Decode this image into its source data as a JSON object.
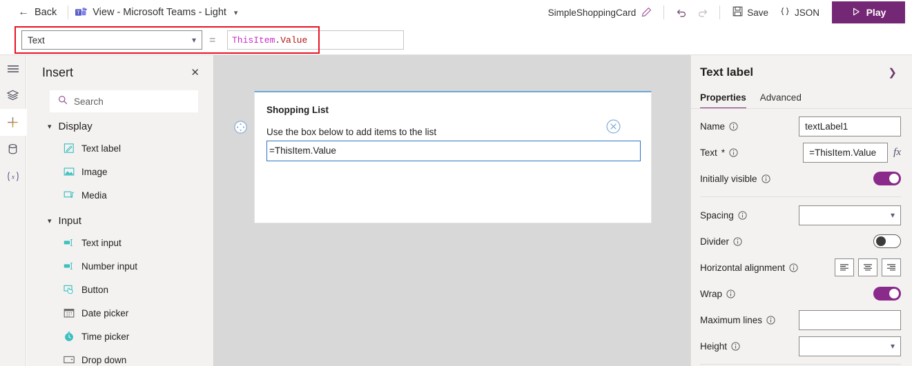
{
  "topbar": {
    "back_label": "Back",
    "app_title": "View - Microsoft Teams - Light",
    "doc_name": "SimpleShoppingCard",
    "edit_icon": "pencil-icon",
    "undo_icon": "undo-icon",
    "redo_icon": "redo-icon",
    "save_label": "Save",
    "json_label": "JSON",
    "json_icon": "braces-icon",
    "play_label": "Play"
  },
  "formula_bar": {
    "property": "Text",
    "equals": "=",
    "formula_object": "ThisItem",
    "formula_dot": ".",
    "formula_property": "Value",
    "highlight_color": "#e81123"
  },
  "rail": {
    "items": [
      {
        "name": "menu-icon",
        "label": "Menu",
        "active": false
      },
      {
        "name": "tree-view-icon",
        "label": "Tree view",
        "active": false
      },
      {
        "name": "plus-icon",
        "label": "Insert",
        "active": true
      },
      {
        "name": "data-icon",
        "label": "Data",
        "active": false
      },
      {
        "name": "variables-icon",
        "label": "Variables",
        "active": false
      }
    ]
  },
  "insert": {
    "title": "Insert",
    "close_icon": "close-icon",
    "search_placeholder": "Search",
    "groups": [
      {
        "label": "Display",
        "items": [
          {
            "label": "Text label",
            "icon": "text-label-icon"
          },
          {
            "label": "Image",
            "icon": "image-icon"
          },
          {
            "label": "Media",
            "icon": "media-icon"
          }
        ]
      },
      {
        "label": "Input",
        "items": [
          {
            "label": "Text input",
            "icon": "text-input-icon"
          },
          {
            "label": "Number input",
            "icon": "number-input-icon"
          },
          {
            "label": "Button",
            "icon": "button-icon"
          },
          {
            "label": "Date picker",
            "icon": "calendar-icon"
          },
          {
            "label": "Time picker",
            "icon": "clock-icon"
          },
          {
            "label": "Drop down",
            "icon": "dropdown-icon"
          }
        ]
      }
    ]
  },
  "canvas": {
    "card_title": "Shopping List",
    "card_subtitle": "Use the box below to add items to the list",
    "selected_value": "=ThisItem.Value",
    "move_handle_icon": "move-handle-icon",
    "delete_handle_icon": "delete-circle-icon",
    "selection_color": "#2a72c4"
  },
  "properties": {
    "title": "Text label",
    "collapse_icon": "chevron-right-icon",
    "tabs": [
      {
        "label": "Properties",
        "active": true
      },
      {
        "label": "Advanced",
        "active": false
      }
    ],
    "fields": {
      "name_label": "Name",
      "name_value": "textLabel1",
      "text_label": "Text",
      "text_required": "*",
      "text_value": "=ThisItem.Value",
      "fx_label": "fx",
      "initially_visible_label": "Initially visible",
      "initially_visible_on": true,
      "spacing_label": "Spacing",
      "spacing_value": "",
      "divider_label": "Divider",
      "divider_on": false,
      "horizontal_alignment_label": "Horizontal alignment",
      "wrap_label": "Wrap",
      "wrap_on": true,
      "maximum_lines_label": "Maximum lines",
      "maximum_lines_value": "",
      "height_label": "Height",
      "height_value": ""
    },
    "accent_color": "#742774"
  }
}
